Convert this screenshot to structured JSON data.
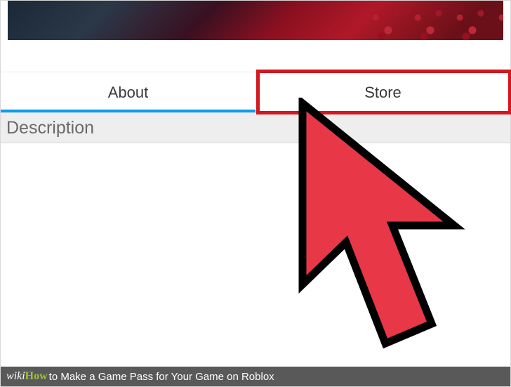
{
  "tabs": {
    "about": "About",
    "store": "Store"
  },
  "section": {
    "title": "Description"
  },
  "footer": {
    "brand_wiki": "wiki",
    "brand_how": "How",
    "article_title": " to Make a Game Pass for Your Game on Roblox"
  }
}
